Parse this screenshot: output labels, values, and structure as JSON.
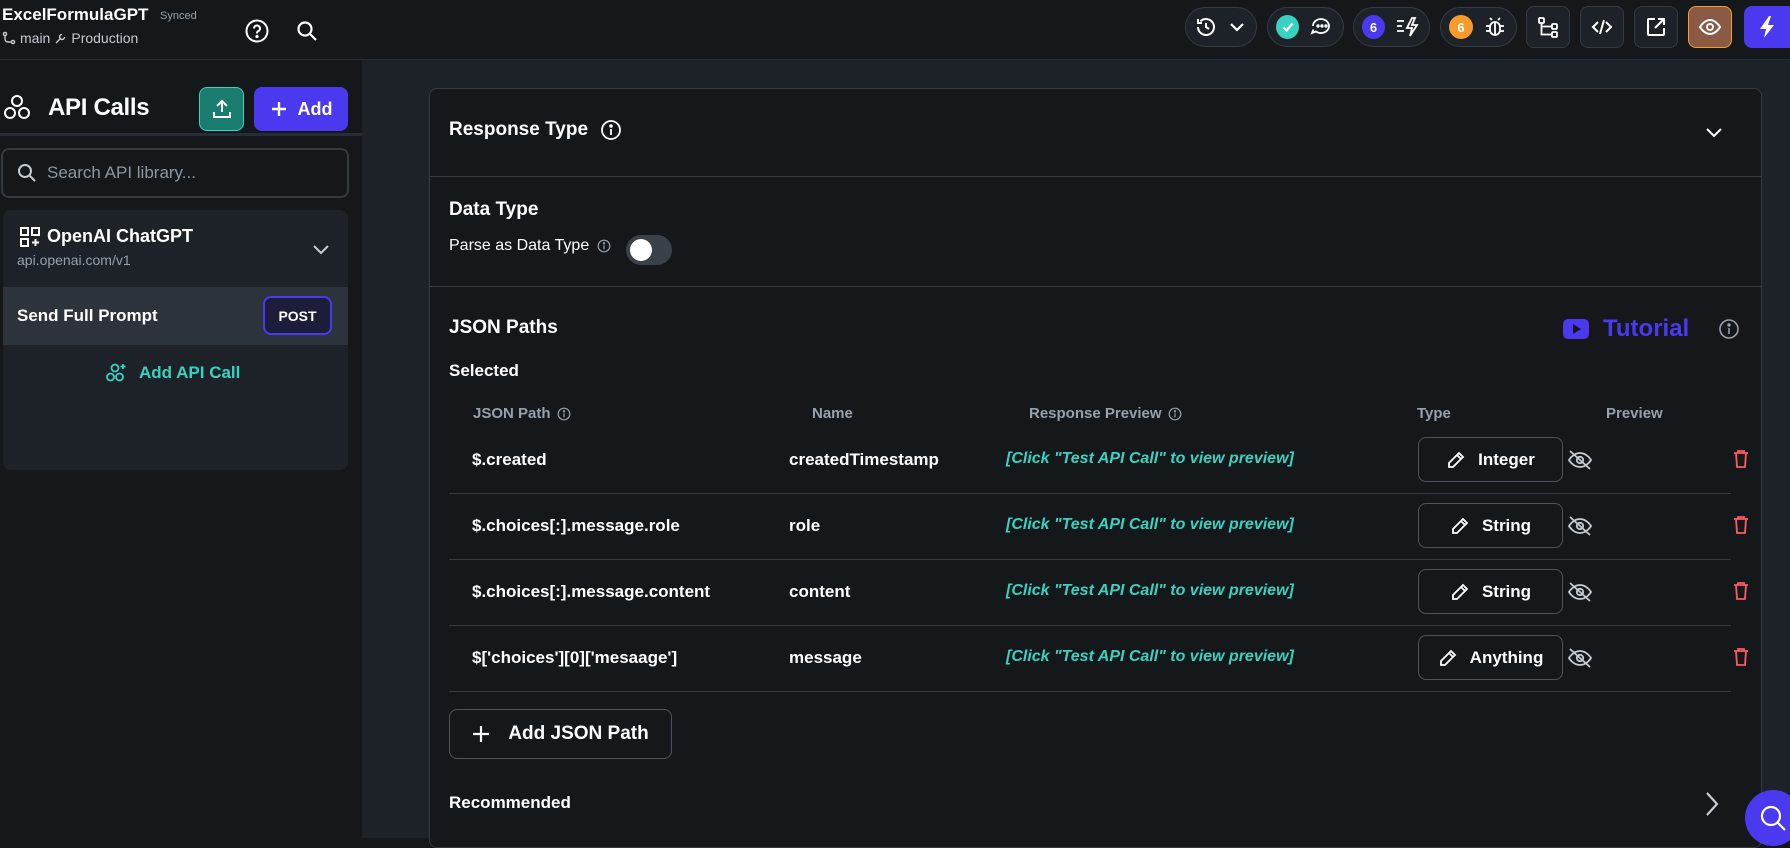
{
  "project": {
    "name": "ExcelFormulaGPT",
    "sync_status": "Synced",
    "branch": "main",
    "environment": "Production"
  },
  "topbar": {
    "undo_badge_count": "",
    "comments_check": "",
    "notifications_count": "6",
    "issues_count": "6"
  },
  "sidebar": {
    "title": "API Calls",
    "add_label": "Add",
    "search_placeholder": "Search API library...",
    "group": {
      "name": "OpenAI ChatGPT",
      "url": "api.openai.com/v1"
    },
    "call": {
      "name": "Send Full Prompt",
      "method": "POST"
    },
    "add_call_label": "Add API Call"
  },
  "main": {
    "response_type_title": "Response Type",
    "data_type_title": "Data Type",
    "parse_label": "Parse as Data Type",
    "parse_enabled": false,
    "json_paths_title": "JSON Paths",
    "tutorial_label": "Tutorial",
    "selected_label": "Selected",
    "columns": {
      "path": "JSON Path",
      "name": "Name",
      "preview": "Response Preview",
      "type": "Type",
      "preview_toggle": "Preview"
    },
    "rows": [
      {
        "path": "$.created",
        "name": "createdTimestamp",
        "preview": "[Click \"Test API Call\" to view preview]",
        "type": "Integer"
      },
      {
        "path": "$.choices[:].message.role",
        "name": "role",
        "preview": "[Click \"Test API Call\" to view preview]",
        "type": "String"
      },
      {
        "path": "$.choices[:].message.content",
        "name": "content",
        "preview": "[Click \"Test API Call\" to view preview]",
        "type": "String"
      },
      {
        "path": "$['choices'][0]['mesaage']",
        "name": "message",
        "preview": "[Click \"Test API Call\" to view preview]",
        "type": "Anything"
      }
    ],
    "add_json_path_label": "Add JSON Path",
    "recommended_label": "Recommended"
  },
  "colors": {
    "accent": "#4b39ef",
    "teal": "#39d2c0",
    "danger": "#ff5963",
    "orange": "#f99b2a"
  }
}
